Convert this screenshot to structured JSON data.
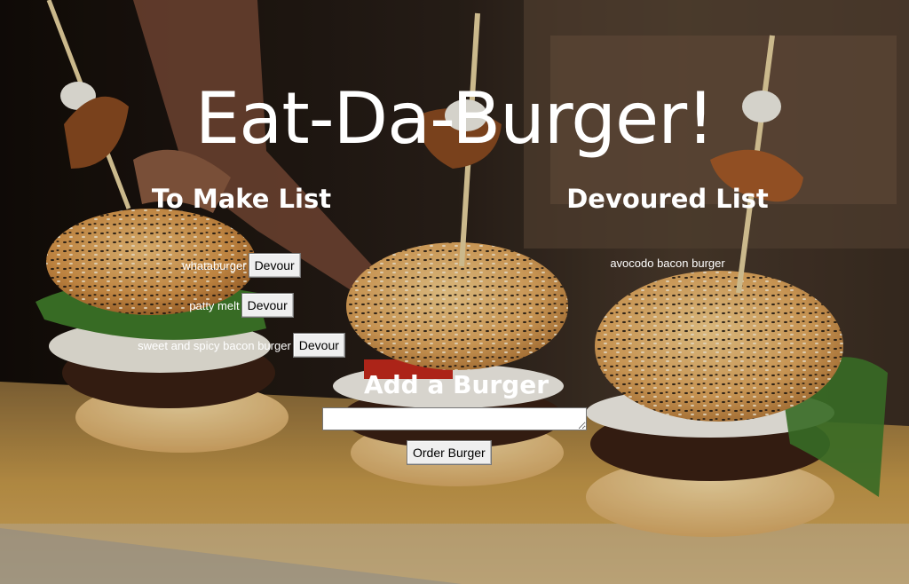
{
  "page": {
    "title": "Eat-Da-Burger!"
  },
  "to_make": {
    "heading": "To Make List",
    "items": [
      {
        "name": "whataburger",
        "button": "Devour"
      },
      {
        "name": "patty melt",
        "button": "Devour"
      },
      {
        "name": "sweet and spicy bacon burger",
        "button": "Devour"
      }
    ]
  },
  "devoured": {
    "heading": "Devoured List",
    "items": [
      {
        "name": "avocodo bacon burger"
      }
    ]
  },
  "add_form": {
    "heading": "Add a Burger",
    "input_value": "",
    "submit_label": "Order Burger"
  },
  "colors": {
    "text": "#ffffff",
    "button_bg": "#efefef"
  }
}
